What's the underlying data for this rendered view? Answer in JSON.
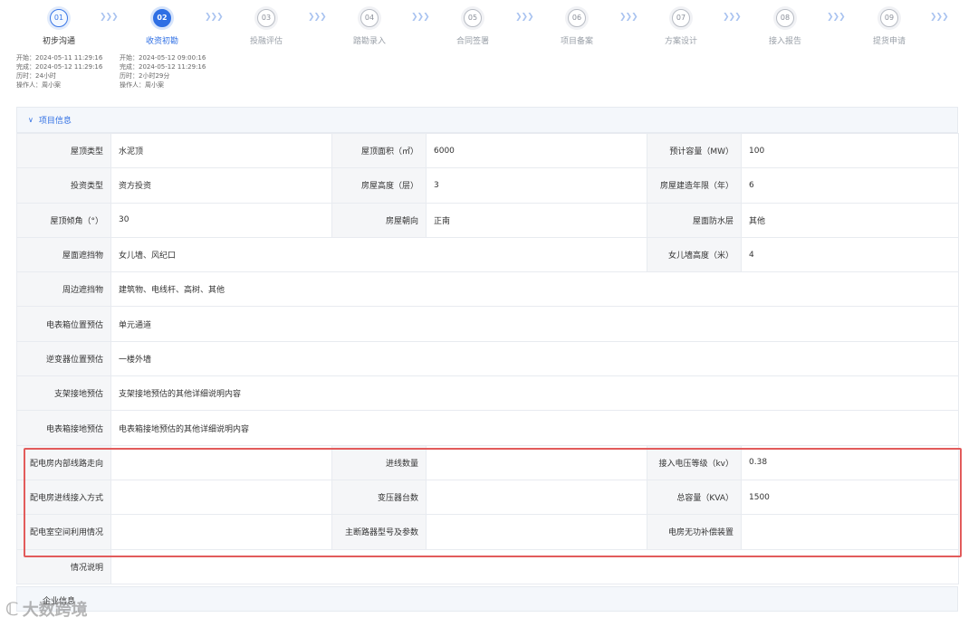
{
  "steps": [
    {
      "num": "01",
      "label": "初步沟通"
    },
    {
      "num": "02",
      "label": "收资初勘"
    },
    {
      "num": "03",
      "label": "投融评估"
    },
    {
      "num": "04",
      "label": "踏勘录入"
    },
    {
      "num": "05",
      "label": "合同签署"
    },
    {
      "num": "06",
      "label": "项目备案"
    },
    {
      "num": "07",
      "label": "方案设计"
    },
    {
      "num": "08",
      "label": "接入报告"
    },
    {
      "num": "09",
      "label": "提货申请"
    }
  ],
  "arrow_glyph": "❯❯❯",
  "meta": [
    {
      "start": "开始：2024-05-11 11:29:16",
      "finish": "完成：2024-05-12 11:29:16",
      "duration": "历时：24小时",
      "operator": "操作人：周小案"
    },
    {
      "start": "开始：2024-05-12 09:00:16",
      "finish": "完成：2024-05-12 11:29:16",
      "duration": "历时：2小时29分",
      "operator": "操作人：周小案"
    }
  ],
  "section": {
    "title": "项目信息",
    "chevron": "∨"
  },
  "rows": {
    "r1": {
      "l1": "屋顶类型",
      "v1": "水泥顶",
      "l2": "屋顶面积（㎡）",
      "v2": "6000",
      "l3": "预计容量（MW）",
      "v3": "100"
    },
    "r2": {
      "l1": "投资类型",
      "v1": "资方投资",
      "l2": "房屋高度（层）",
      "v2": "3",
      "l3": "房屋建造年限（年）",
      "v3": "6"
    },
    "r3": {
      "l1": "屋顶倾角（°）",
      "v1": "30",
      "l2": "房屋朝向",
      "v2": "正南",
      "l3": "屋面防水层",
      "v3": "其他"
    },
    "r4": {
      "l1": "屋面遮挡物",
      "v1": "女儿墙、风纪口",
      "l3": "女儿墙高度（米）",
      "v3": "4"
    },
    "r5": {
      "l1": "周边遮挡物",
      "v1": "建筑物、电线杆、高树、其他"
    },
    "r6": {
      "l1": "电表箱位置预估",
      "v1": "单元通道"
    },
    "r7": {
      "l1": "逆变器位置预估",
      "v1": "一楼外墙"
    },
    "r8": {
      "l1": "支架接地预估",
      "v1": "支架接地预估的其他详细说明内容"
    },
    "r9": {
      "l1": "电表箱接地预估",
      "v1": "电表箱接地预估的其他详细说明内容"
    },
    "r10": {
      "l1": "配电房内部线路走向",
      "v1": "",
      "l2": "进线数量",
      "v2": "",
      "l3": "接入电压等级（kv）",
      "v3": "0.38"
    },
    "r11": {
      "l1": "配电房进线接入方式",
      "v1": "",
      "l2": "变压器台数",
      "v2": "",
      "l3": "总容量（KVA）",
      "v3": "1500"
    },
    "r12": {
      "l1": "配电室空间利用情况",
      "v1": "",
      "l2": "主断路器型号及参数",
      "v2": "",
      "l3": "电房无功补偿装置",
      "v3": ""
    },
    "r13": {
      "l1": "情况说明",
      "v1": ""
    }
  },
  "section2": {
    "title": "企业信息"
  },
  "watermark": {
    "text": "大数跨境",
    "logo": "ℂ"
  },
  "colors": {
    "accent": "#2f6fe4",
    "highlight": "#e25b5b"
  }
}
